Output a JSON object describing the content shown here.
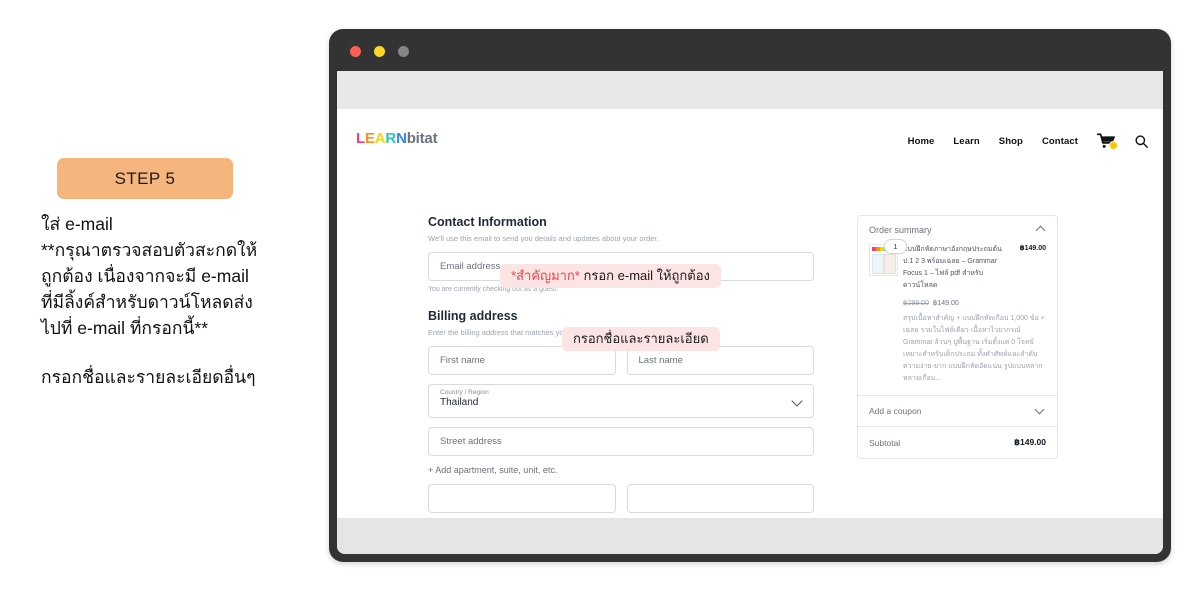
{
  "instructions": {
    "step_badge": "STEP 5",
    "lines": [
      "ใส่ e-mail",
      "**กรุณาตรวจสอบตัวสะกดให้",
      "ถูกต้อง เนื่องจากจะมี e-mail",
      "ที่มีลิ้งค์สำหรับดาวน์โหลดส่ง",
      "ไปที่ e-mail ที่กรอกนี้**"
    ],
    "final_line": "กรอกชื่อและรายละเอียดอื่นๆ",
    "badge_color": "#f6b57c"
  },
  "browser": {
    "dots": [
      "close",
      "minimize",
      "maximize"
    ],
    "dot_colors": {
      "close": "#ff5f56",
      "minimize": "#fbd727",
      "maximize": "#848484"
    }
  },
  "site": {
    "logo": {
      "l": "L",
      "e": "E",
      "a": "A",
      "r": "R",
      "n": "N",
      "rest": "bitat"
    },
    "nav": [
      "Home",
      "Learn",
      "Shop",
      "Contact"
    ],
    "cart_icon": "cart-icon",
    "search_icon": "search-icon"
  },
  "contact": {
    "title": "Contact Information",
    "subtitle": "We'll use this email to send you details and updates about your order.",
    "email_placeholder": "Email address",
    "guest_note": "You are currently checking out as a guest."
  },
  "billing": {
    "title": "Billing address",
    "subtitle": "Enter the billing address that matches your payment method.",
    "first_name_placeholder": "First name",
    "last_name_placeholder": "Last name",
    "country_label": "Country / Region",
    "country_value": "Thailand",
    "street_placeholder": "Street address",
    "add_apartment_link": "+ Add apartment, suite, unit, etc."
  },
  "annotations": {
    "email": {
      "emphasis": "*สำคัญมาก*",
      "text": " กรอก e-mail ให้ถูกต้อง",
      "bg": "#fce4e4",
      "emphasis_color": "#ef4444"
    },
    "billing": {
      "text": "กรอกชื่อและรายละเอียด",
      "bg": "#fce4e4"
    }
  },
  "summary": {
    "heading": "Order summary",
    "quantity": "1",
    "item_title": "แบบฝึกหัดภาษาอังกฤษประถมต้น ป.1 2 3 พร้อมเฉลย – Grammar Focus 1 – ไฟล์ pdf สำหรับดาวน์โหลด",
    "item_price": "฿149.00",
    "old_price": "฿299.00",
    "new_price": "฿149.00",
    "item_description": "สรุปเนื้อหาสำคัญ + แบบฝึกหัดเกือบ 1,000 ข้อ + เฉลย รวมในไฟล์เดียว เนื้อหาไวยากรณ์ Grammar ล้วนๆ ปูพื้นฐาน เริ่มตั้งแต่ 0 โจทย์เหมาะสำหรับเด็กประถม ทั้งคำศัพท์และลำดับความง่าย-ยาก แบบฝึกหัดอัดแน่น รูปแบบหลากหลายเกือบ...",
    "coupon_label": "Add a coupon",
    "subtotal_label": "Subtotal",
    "subtotal_value": "฿149.00"
  }
}
